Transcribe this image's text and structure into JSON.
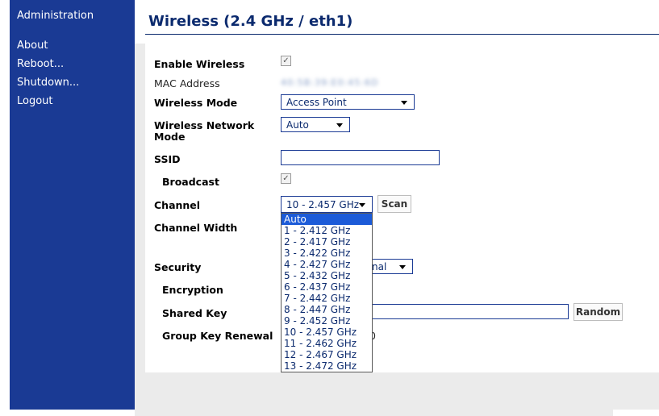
{
  "sidebar": {
    "items": [
      {
        "label": "Administration"
      },
      {
        "label": "About"
      },
      {
        "label": "Reboot..."
      },
      {
        "label": "Shutdown..."
      },
      {
        "label": "Logout"
      }
    ]
  },
  "page": {
    "title": "Wireless (2.4 GHz / eth1)"
  },
  "form": {
    "enable_wireless": {
      "label": "Enable Wireless",
      "checked": true
    },
    "mac_address": {
      "label": "MAC Address",
      "value": "40:5B:39:E0:45:6D"
    },
    "wireless_mode": {
      "label": "Wireless Mode",
      "value": "Access Point"
    },
    "network_mode": {
      "label_line1": "Wireless Network",
      "label_line2": "Mode",
      "value": "Auto"
    },
    "ssid": {
      "label": "SSID",
      "value": ""
    },
    "broadcast": {
      "label": "Broadcast",
      "checked": true
    },
    "channel": {
      "label": "Channel",
      "value": "10 - 2.457 GHz",
      "scan_label": "Scan",
      "options": [
        "Auto",
        "1 - 2.412 GHz",
        "2 - 2.417 GHz",
        "3 - 2.422 GHz",
        "4 - 2.427 GHz",
        "5 - 2.432 GHz",
        "6 - 2.437 GHz",
        "7 - 2.442 GHz",
        "8 - 2.447 GHz",
        "9 - 2.452 GHz",
        "10 - 2.457 GHz",
        "11 - 2.462 GHz",
        "12 - 2.467 GHz",
        "13 - 2.472 GHz"
      ],
      "highlighted_option": "Auto"
    },
    "channel_width": {
      "label": "Channel Width"
    },
    "security": {
      "label": "Security",
      "value_visible_fragment": "nal"
    },
    "encryption": {
      "label": "Encryption"
    },
    "shared_key": {
      "label": "Shared Key",
      "random_label": "Random"
    },
    "group_key_renewal": {
      "label": "Group Key Renewal",
      "value_visible_fragment": "0"
    }
  },
  "colors": {
    "sidebar_bg": "#1a3a94",
    "title_color": "#0b2a6e",
    "content_bg": "#ebebeb",
    "dropdown_highlight": "#1c5bd8"
  }
}
